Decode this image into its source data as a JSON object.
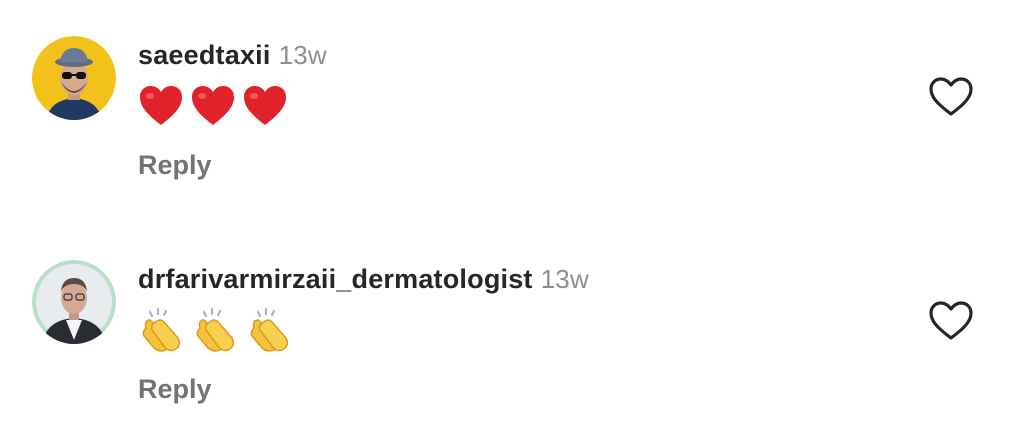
{
  "comments": [
    {
      "username": "saeedtaxii",
      "time": "13w",
      "emojis": [
        "heart-emoji",
        "heart-emoji",
        "heart-emoji"
      ],
      "reply_label": "Reply",
      "avatar_bg": "#f2c21b"
    },
    {
      "username": "drfarivarmirzaii_dermatologist",
      "time": "13w",
      "emojis": [
        "clapping-hands-emoji",
        "clapping-hands-emoji",
        "clapping-hands-emoji"
      ],
      "reply_label": "Reply",
      "avatar_bg": "#e8ecef"
    }
  ],
  "colors": {
    "text": "#262626",
    "secondary": "#8e8e8e",
    "reply": "#737373",
    "heart": "#e0222b",
    "clap": "#f5c33b"
  },
  "icons": {
    "like": "heart-outline-icon"
  }
}
